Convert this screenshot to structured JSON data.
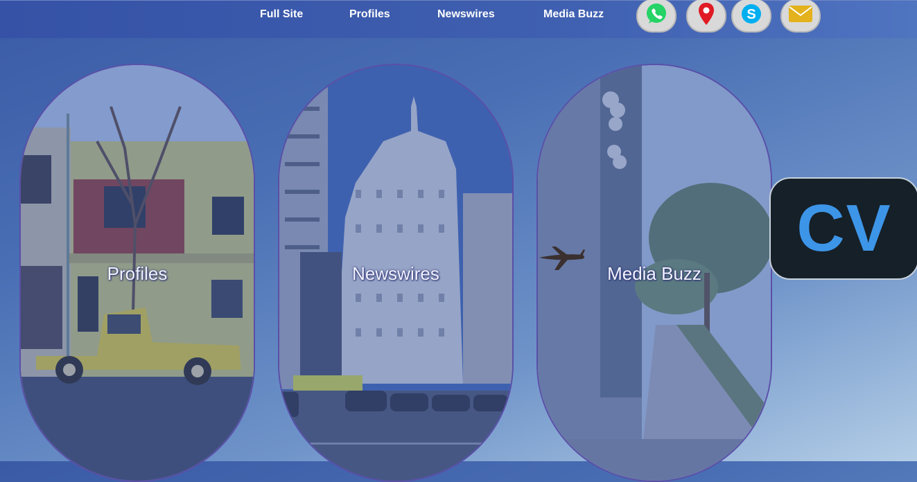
{
  "nav": {
    "links": [
      {
        "label": "Full Site"
      },
      {
        "label": "Profiles"
      },
      {
        "label": "Newswires"
      },
      {
        "label": "Media Buzz"
      }
    ],
    "social": [
      {
        "icon": "whatsapp-icon",
        "color": "#25d366"
      },
      {
        "icon": "location-pin-icon",
        "color": "#e01b24"
      },
      {
        "icon": "skype-icon",
        "color": "#00aff0"
      },
      {
        "icon": "email-icon",
        "color": "#e3b21c"
      }
    ]
  },
  "cards": [
    {
      "label": "Profiles"
    },
    {
      "label": "Newswires"
    },
    {
      "label": "Media Buzz"
    }
  ],
  "badge": {
    "text": "CV",
    "color": "#3d95e8"
  }
}
